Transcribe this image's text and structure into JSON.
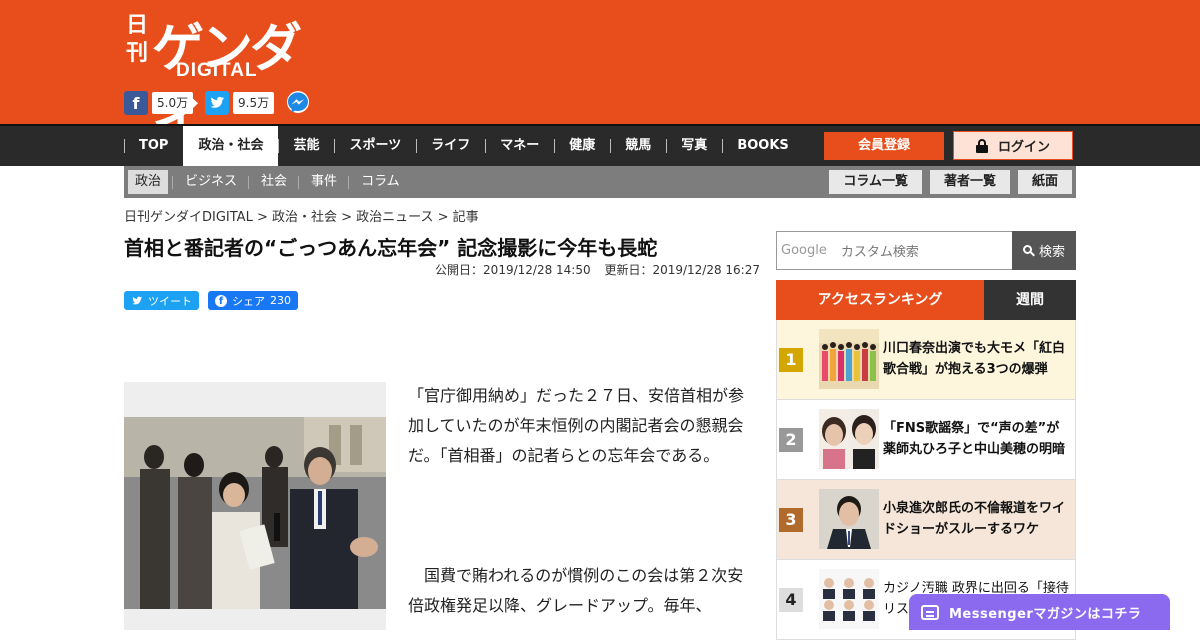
{
  "header": {
    "logo_vertical": "日刊",
    "logo_main": "ゲンダイ",
    "logo_sub": "DIGITAL",
    "facebook_count": "5.0万",
    "twitter_count": "9.5万"
  },
  "nav": {
    "items": [
      "TOP",
      "政治・社会",
      "芸能",
      "スポーツ",
      "ライフ",
      "マネー",
      "健康",
      "競馬",
      "写真",
      "BOOKS"
    ],
    "active_index": 1,
    "register_label": "会員登録",
    "login_label": "ログイン"
  },
  "subnav": {
    "items": [
      "政治",
      "ビジネス",
      "社会",
      "事件",
      "コラム"
    ],
    "buttons": [
      "コラム一覧",
      "著者一覧",
      "紙面"
    ]
  },
  "breadcrumb": "日刊ゲンダイDIGITAL > 政治・社会 > 政治ニュース > 記事",
  "article": {
    "title": "首相と番記者の“ごっつあん忘年会” 記念撮影に今年も長蛇",
    "published": "公開日：2019/12/28 14:50",
    "updated": "更新日：2019/12/28 16:27",
    "tweet_label": "ツイート",
    "share_label": "シェア",
    "share_count": "230",
    "paragraph1": "「官庁御用納め」だった２７日、安倍首相が参加していたのが年末恒例の内閣記者会の懇親会だ。「首相番」の記者らとの忘年会である。",
    "paragraph2": "　国費で賄われるのが慣例のこの会は第２次安倍政権発足以降、グレードアップ。毎年、"
  },
  "search": {
    "google_label": "Google",
    "placeholder": "カスタム検索",
    "button_label": "検索"
  },
  "ranking": {
    "tab_access": "アクセスランキング",
    "tab_weekly": "週間",
    "items": [
      {
        "rank": "1",
        "text": "川口春奈出演でも大モメ「紅白歌合戦」が抱える3つの爆弾"
      },
      {
        "rank": "2",
        "text": "「FNS歌謡祭」で“声の差”が 薬師丸ひろ子と中山美穂の明暗"
      },
      {
        "rank": "3",
        "text": "小泉進次郎氏の不倫報道をワイドショーがスルーするワケ"
      },
      {
        "rank": "4",
        "text": "カジノ汚職 政界に出回る「接待リスト」"
      }
    ]
  },
  "messenger": {
    "label": "Messengerマガジンはコチラ"
  },
  "colors": {
    "brand": "#e84e1b",
    "rank1": "#d4a600",
    "rank2": "#999999",
    "rank3": "#b06a2c",
    "messenger": "#8b6af0"
  }
}
